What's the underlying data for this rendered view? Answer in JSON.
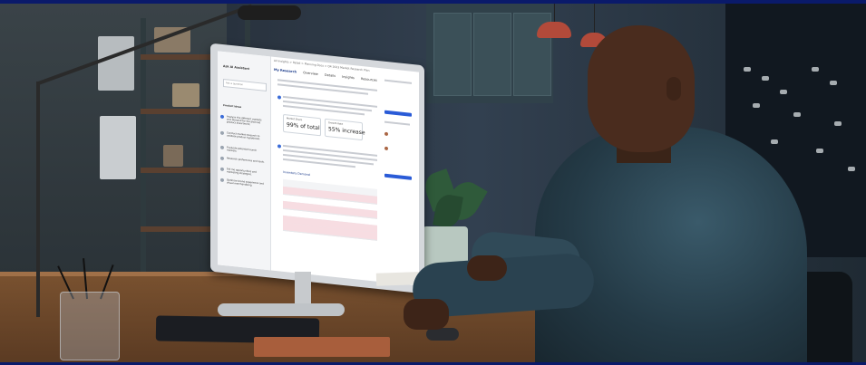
{
  "screen": {
    "breadcrumb": "All Insights > Retail > Planning Docs > Q4 2023 Market Research Plan",
    "tabs": [
      "My Research",
      "Overview",
      "Details",
      "Insights",
      "Resources"
    ],
    "sidebar": {
      "title": "Ask AI Assistant",
      "input_placeholder": "Ask a question",
      "section_title": "Product Ideas",
      "items": [
        "Analyze the different markets and demand for the planned product assortment.",
        "Conduct market research to validate product hypothesis.",
        "Evaluate potential launch markets.",
        "Research preferences and tools.",
        "Tell me opportunities and marketing strategies.",
        "Optimize brand experience and visual merchandising."
      ]
    },
    "metrics": [
      {
        "label": "Market Share",
        "value": "99% of total"
      },
      {
        "label": "Growth Rate",
        "value": "55% increase"
      }
    ],
    "table_title": "Inventory Demand"
  },
  "colors": {
    "accent": "#2a5bd7",
    "highlight_row": "#f7dde2",
    "frame": "#0a1a6a"
  }
}
